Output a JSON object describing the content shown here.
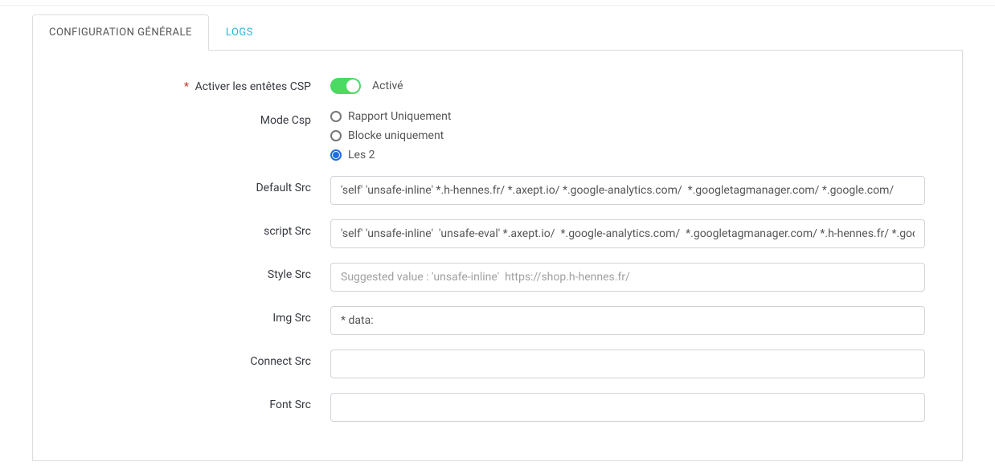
{
  "tabs": {
    "general": "CONFIGURATION GÉNÉRALE",
    "logs": "LOGS"
  },
  "form": {
    "enable_csp": {
      "label": "Activer les entêtes CSP",
      "required": true,
      "status_label": "Activé"
    },
    "mode_csp": {
      "label": "Mode Csp",
      "options": {
        "report_only": "Rapport Uniquement",
        "block_only": "Blocke uniquement",
        "both": "Les 2"
      },
      "selected": "both"
    },
    "default_src": {
      "label": "Default Src",
      "value": "'self' 'unsafe-inline' *.h-hennes.fr/ *.axept.io/ *.google-analytics.com/  *.googletagmanager.com/ *.google.com/"
    },
    "script_src": {
      "label": "script Src",
      "value": "'self' 'unsafe-inline'  'unsafe-eval' *.axept.io/  *.google-analytics.com/  *.googletagmanager.com/ *.h-hennes.fr/ *.googl"
    },
    "style_src": {
      "label": "Style Src",
      "value": "",
      "placeholder": "Suggested value : 'unsafe-inline'  https://shop.h-hennes.fr/"
    },
    "img_src": {
      "label": "Img Src",
      "value": "* data:"
    },
    "connect_src": {
      "label": "Connect Src",
      "value": ""
    },
    "font_src": {
      "label": "Font Src",
      "value": ""
    }
  }
}
